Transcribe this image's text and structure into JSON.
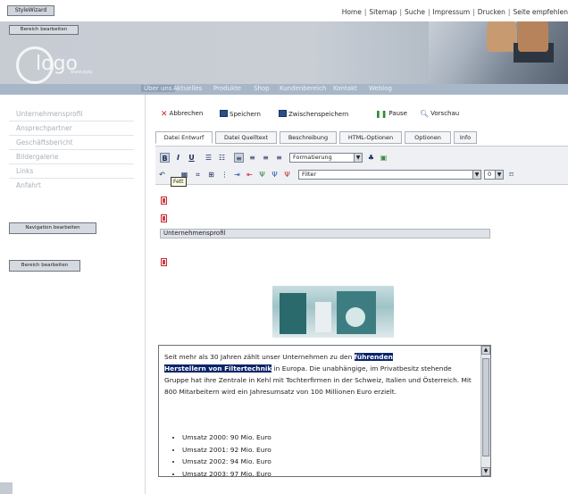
{
  "top": {
    "stylewizard_label": "StyleWizard",
    "nav": [
      "Home",
      "Sitemap",
      "Suche",
      "Impressum",
      "Drucken",
      "Seite empfehlen"
    ]
  },
  "header": {
    "bereich_label": "Bereich bearbeiten",
    "logo_text": "logo",
    "logo_tagline": "www.epiq"
  },
  "mainnav": {
    "items": [
      "Über uns",
      "Aktuelles",
      "Produkte",
      "Shop",
      "Kundenbereich",
      "Kontakt",
      "Weblog"
    ]
  },
  "sidebar": {
    "links": [
      "Unternehmensprofil",
      "Ansprechpartner",
      "Geschäftsbericht",
      "Bildergalerie",
      "Links",
      "Anfahrt"
    ],
    "nav_button": "Navigation bearbeiten",
    "bereich_button": "Bereich bearbeiten"
  },
  "toolbar": {
    "cancel": "Abbrechen",
    "save": "Speichern",
    "intermediate_save": "Zwischenspeichern",
    "pause": "Pause",
    "preview": "Vorschau"
  },
  "tabs": [
    "Datei Entwurf",
    "Datei Quelltext",
    "Beschreibung",
    "HTML-Optionen",
    "Optionen",
    "Info"
  ],
  "format": {
    "bold": "B",
    "italic": "I",
    "underline": "U",
    "formatting_select": "Formatierung",
    "filter_select": "Filter",
    "size_select": "0",
    "tooltip": "Fett"
  },
  "content": {
    "section_title": "Unternehmensprofil",
    "text_before": "Seit mehr als 30 Jahren zählt unser Unternehmen zu den ",
    "highlight_line1": "führenden",
    "highlight_line2": "Herstellern von Filtertechnik",
    "text_after": " in Europa. Die unabhängige, im Privatbesitz stehende Gruppe hat ihre Zentrale in Kehl mit Tochterfirmen in der Schweiz, Italien und Österreich. Mit 800 Mitarbeitern wird ein Jahresumsatz von 100 Millionen Euro erzielt.",
    "bullets": [
      "Umsatz 2000: 90 Mio. Euro",
      "Umsatz 2001: 92 Mio. Euro",
      "Umsatz 2002: 94 Mio. Euro",
      "Umsatz 2003: 97 Mio. Euro"
    ]
  },
  "colors": {
    "nav_bar": "#a7b7c8",
    "highlight": "#0a246a",
    "cancel_red": "#c9262b"
  }
}
